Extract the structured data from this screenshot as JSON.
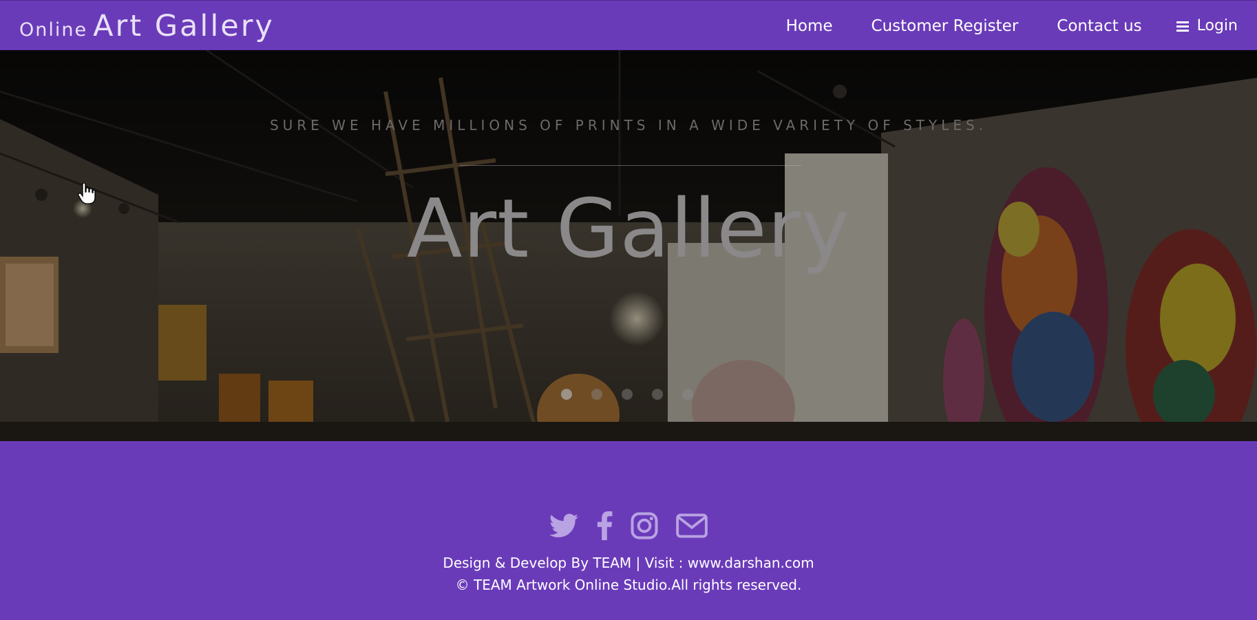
{
  "navbar": {
    "brand_small": "Online",
    "brand_big": "Art Gallery",
    "links": [
      "Home",
      "Customer Register",
      "Contact us"
    ],
    "login_label": "Login",
    "login_icon": "menu-icon"
  },
  "hero": {
    "tagline": "SURE WE HAVE MILLIONS OF PRINTS IN A WIDE VARIETY OF STYLES.",
    "title": "Art Gallery",
    "slide_count": 5,
    "active_slide": 1
  },
  "footer": {
    "social_icons": [
      "twitter-icon",
      "facebook-icon",
      "instagram-icon",
      "email-icon"
    ],
    "credit": "Design & Develop By TEAM | Visit : www.darshan.com",
    "copyright": "© TEAM Artwork Online Studio.All rights reserved."
  },
  "colors": {
    "brand": "#6a3bb9",
    "nav_text": "#ffffff",
    "social_icon": "#b9a3e3"
  }
}
